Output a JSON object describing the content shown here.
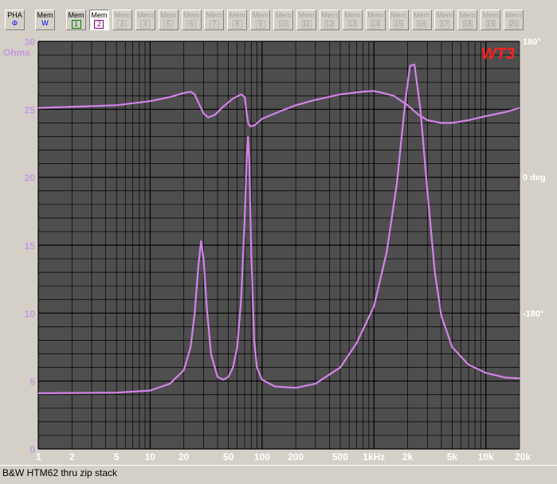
{
  "toolbar": {
    "pha": {
      "top": "PHA",
      "bottom": "Φ"
    },
    "mem_w": {
      "top": "Mem",
      "bottom": "W"
    },
    "mem_prefix": "Mem",
    "mem_numbers": [
      "1",
      "2",
      "3",
      "4",
      "5",
      "6",
      "7",
      "8",
      "9",
      "10",
      "11",
      "12",
      "13",
      "14",
      "15",
      "16",
      "17",
      "18",
      "19",
      "20"
    ],
    "mem_states": [
      "active",
      "selected",
      "disabled",
      "disabled",
      "disabled",
      "disabled",
      "disabled",
      "disabled",
      "disabled",
      "disabled",
      "disabled",
      "disabled",
      "disabled",
      "disabled",
      "disabled",
      "disabled",
      "disabled",
      "disabled",
      "disabled",
      "disabled"
    ]
  },
  "caption": "B&W HTM62 thru zip stack",
  "colors": {
    "plot_bg": "#4e4e4e",
    "grid": "#000000",
    "curve": "#d383e8",
    "left_labels": "#c79ade",
    "right_labels": "#ffffff",
    "axis_labels": "#ffffff",
    "logo": "#ff2020",
    "mem1_number": "#008000",
    "mem2_number": "#800080",
    "pha_symbol": "#0000ff",
    "memw_symbol": "#0000ff"
  },
  "chart_data": {
    "type": "line",
    "logo": "WT3",
    "x_scale": "log",
    "xlim": [
      1,
      20000
    ],
    "ylim": [
      0,
      30
    ],
    "ylabel": "Ohms",
    "x_ticks": [
      {
        "v": 1,
        "label": "1"
      },
      {
        "v": 2,
        "label": "2"
      },
      {
        "v": 5,
        "label": "5"
      },
      {
        "v": 10,
        "label": "10"
      },
      {
        "v": 20,
        "label": "20"
      },
      {
        "v": 50,
        "label": "50"
      },
      {
        "v": 100,
        "label": "100"
      },
      {
        "v": 200,
        "label": "200"
      },
      {
        "v": 500,
        "label": "500"
      },
      {
        "v": 1000,
        "label": "1kHz"
      },
      {
        "v": 2000,
        "label": "2k"
      },
      {
        "v": 5000,
        "label": "5k"
      },
      {
        "v": 10000,
        "label": "10k"
      },
      {
        "v": 20000,
        "label": "20k"
      }
    ],
    "y_ticks": [
      0,
      5,
      10,
      15,
      20,
      25,
      30
    ],
    "right_axis": {
      "range": [
        -180,
        180
      ],
      "ticks": [
        {
          "v": 180,
          "label": "180°"
        },
        {
          "v": 0,
          "label": "0 deg"
        },
        {
          "v": -180,
          "label": "-180°"
        }
      ]
    },
    "series": [
      {
        "values": [
          [
            1,
            4.1
          ],
          [
            5,
            4.15
          ],
          [
            10,
            4.3
          ],
          [
            15,
            4.8
          ],
          [
            20,
            5.8
          ],
          [
            23,
            7.5
          ],
          [
            25,
            10.0
          ],
          [
            27,
            13.5
          ],
          [
            28.5,
            15.3
          ],
          [
            30,
            14.0
          ],
          [
            32,
            10.5
          ],
          [
            35,
            7.0
          ],
          [
            40,
            5.3
          ],
          [
            45,
            5.1
          ],
          [
            50,
            5.3
          ],
          [
            55,
            6.0
          ],
          [
            60,
            7.5
          ],
          [
            65,
            11.0
          ],
          [
            70,
            17.0
          ],
          [
            73,
            21.5
          ],
          [
            75,
            23.0
          ],
          [
            77,
            21.0
          ],
          [
            80,
            14.5
          ],
          [
            85,
            8.0
          ],
          [
            90,
            6.0
          ],
          [
            100,
            5.1
          ],
          [
            130,
            4.6
          ],
          [
            200,
            4.5
          ],
          [
            300,
            4.8
          ],
          [
            500,
            6.0
          ],
          [
            700,
            7.8
          ],
          [
            1000,
            10.5
          ],
          [
            1300,
            14.5
          ],
          [
            1600,
            19.5
          ],
          [
            1900,
            25.5
          ],
          [
            2100,
            28.2
          ],
          [
            2300,
            28.3
          ],
          [
            2600,
            25.0
          ],
          [
            3000,
            19.0
          ],
          [
            3500,
            13.0
          ],
          [
            4000,
            9.8
          ],
          [
            5000,
            7.5
          ],
          [
            7000,
            6.2
          ],
          [
            10000,
            5.6
          ],
          [
            15000,
            5.25
          ],
          [
            20000,
            5.2
          ]
        ]
      },
      {
        "values": [
          [
            1,
            25.1
          ],
          [
            5,
            25.3
          ],
          [
            10,
            25.6
          ],
          [
            15,
            25.9
          ],
          [
            20,
            26.2
          ],
          [
            23,
            26.3
          ],
          [
            25,
            26.1
          ],
          [
            27,
            25.5
          ],
          [
            30,
            24.7
          ],
          [
            33,
            24.4
          ],
          [
            38,
            24.6
          ],
          [
            45,
            25.2
          ],
          [
            55,
            25.8
          ],
          [
            65,
            26.1
          ],
          [
            70,
            25.9
          ],
          [
            73,
            24.7
          ],
          [
            75,
            24.0
          ],
          [
            78,
            23.75
          ],
          [
            85,
            23.8
          ],
          [
            100,
            24.3
          ],
          [
            150,
            24.9
          ],
          [
            200,
            25.3
          ],
          [
            300,
            25.7
          ],
          [
            500,
            26.1
          ],
          [
            800,
            26.3
          ],
          [
            1000,
            26.35
          ],
          [
            1200,
            26.2
          ],
          [
            1500,
            26.0
          ],
          [
            2000,
            25.3
          ],
          [
            2500,
            24.6
          ],
          [
            3000,
            24.2
          ],
          [
            4000,
            24.0
          ],
          [
            5000,
            24.0
          ],
          [
            7000,
            24.2
          ],
          [
            10000,
            24.5
          ],
          [
            15000,
            24.8
          ],
          [
            20000,
            25.1
          ]
        ]
      }
    ]
  }
}
